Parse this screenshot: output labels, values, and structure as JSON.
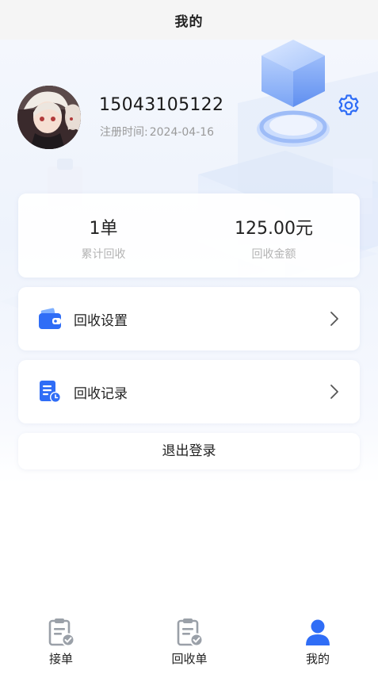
{
  "header": {
    "title": "我的"
  },
  "profile": {
    "phone": "15043105122",
    "register_label": "注册时间:",
    "register_date": "2024-04-16"
  },
  "stats": [
    {
      "value": "1单",
      "label": "累计回收"
    },
    {
      "value": "125.00元",
      "label": "回收金额"
    }
  ],
  "menu": [
    {
      "label": "回收设置",
      "icon": "wallet-icon"
    },
    {
      "label": "回收记录",
      "icon": "document-clock-icon"
    }
  ],
  "logout": {
    "label": "退出登录"
  },
  "tabs": [
    {
      "label": "接单",
      "icon": "clipboard-check-icon",
      "active": false
    },
    {
      "label": "回收单",
      "icon": "clipboard-check-icon",
      "active": false
    },
    {
      "label": "我的",
      "icon": "user-icon",
      "active": true
    }
  ],
  "colors": {
    "accent": "#2f6df6",
    "tab_inactive": "#9aa0a8",
    "muted_text": "#9a9a9a"
  }
}
